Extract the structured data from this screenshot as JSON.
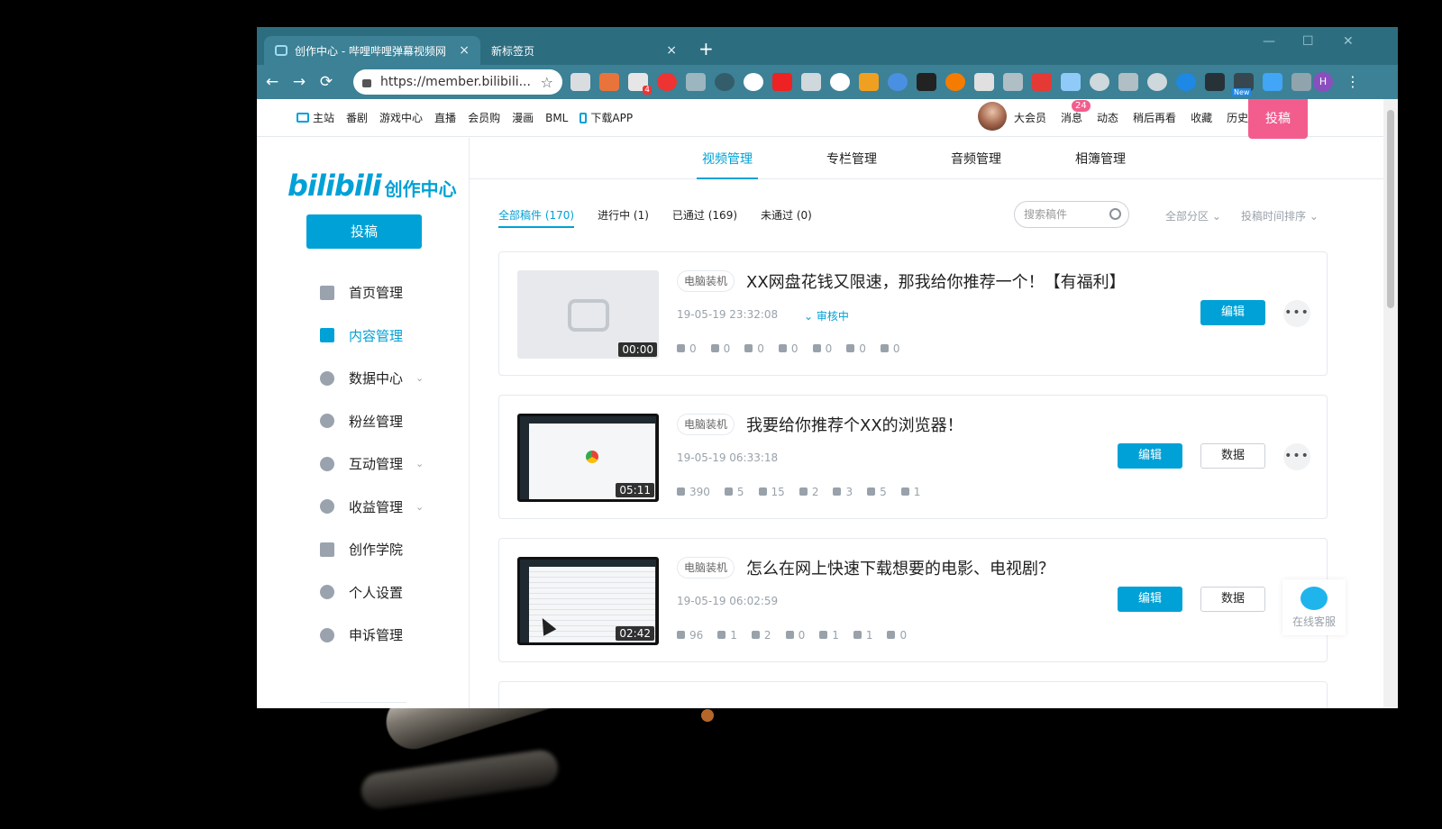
{
  "browser": {
    "tabs": [
      {
        "title": "创作中心 - 哔哩哔哩弹幕视频网",
        "close": "×"
      },
      {
        "title": "新标签页",
        "close": "×"
      }
    ],
    "new_tab": "+",
    "window_controls": {
      "minimize": "—",
      "maximize": "☐",
      "close": "✕"
    },
    "nav": {
      "back": "←",
      "forward": "→",
      "reload": "⟳"
    },
    "url": "https://member.bilibili...",
    "star": "☆",
    "profile": "H",
    "menu": "⋮",
    "extension_badges": {
      "ext3": "4",
      "ext_new": "New"
    }
  },
  "topnav": {
    "left": [
      "主站",
      "番剧",
      "游戏中心",
      "直播",
      "会员购",
      "漫画",
      "BML",
      "下载APP"
    ],
    "right": [
      "大会员",
      "消息",
      "动态",
      "稍后再看",
      "收藏",
      "历史"
    ],
    "message_badge": "24",
    "upload": "投稿"
  },
  "sidebar": {
    "logo_brand": "bilibili",
    "logo_suffix": "创作中心",
    "upload": "投稿",
    "items": [
      {
        "label": "首页管理",
        "icon": "home-icon"
      },
      {
        "label": "内容管理",
        "icon": "document-icon",
        "active": true
      },
      {
        "label": "数据中心",
        "icon": "chart-icon",
        "expand": "⌄"
      },
      {
        "label": "粉丝管理",
        "icon": "fans-icon"
      },
      {
        "label": "互动管理",
        "icon": "chat-icon",
        "expand": "⌄"
      },
      {
        "label": "收益管理",
        "icon": "coin-icon",
        "expand": "⌄"
      },
      {
        "label": "创作学院",
        "icon": "graduation-icon"
      },
      {
        "label": "个人设置",
        "icon": "gear-icon"
      },
      {
        "label": "申诉管理",
        "icon": "shield-icon"
      }
    ]
  },
  "subtabs": [
    "视频管理",
    "专栏管理",
    "音频管理",
    "相簿管理"
  ],
  "filters": {
    "all": "全部稿件 (170)",
    "in_progress": "进行中 (1)",
    "passed": "已通过 (169)",
    "rejected": "未通过 (0)",
    "search_placeholder": "搜索稿件",
    "partition": "全部分区",
    "sort": "投稿时间排序"
  },
  "videos": [
    {
      "tag": "电脑装机",
      "title": "XX网盘花钱又限速，那我给你推荐一个！【有福利】",
      "time": "19-05-19 23:32:08",
      "status": "审核中",
      "duration": "00:00",
      "stats": [
        "0",
        "0",
        "0",
        "0",
        "0",
        "0",
        "0"
      ],
      "edit": "编辑",
      "more": "•••"
    },
    {
      "tag": "电脑装机",
      "title": "我要给你推荐个XX的浏览器！",
      "time": "19-05-19 06:33:18",
      "duration": "05:11",
      "stats": [
        "390",
        "5",
        "15",
        "2",
        "3",
        "5",
        "1"
      ],
      "edit": "编辑",
      "data": "数据",
      "more": "•••"
    },
    {
      "tag": "电脑装机",
      "title": "怎么在网上快速下载想要的电影、电视剧？",
      "time": "19-05-19 06:02:59",
      "duration": "02:42",
      "stats": [
        "96",
        "1",
        "2",
        "0",
        "1",
        "1",
        "0"
      ],
      "edit": "编辑",
      "data": "数据",
      "more": "•••"
    }
  ],
  "service": "在线客服",
  "colors": {
    "accent": "#00a1d6",
    "pink": "#f25d8e",
    "chrome": "#3c8196"
  }
}
